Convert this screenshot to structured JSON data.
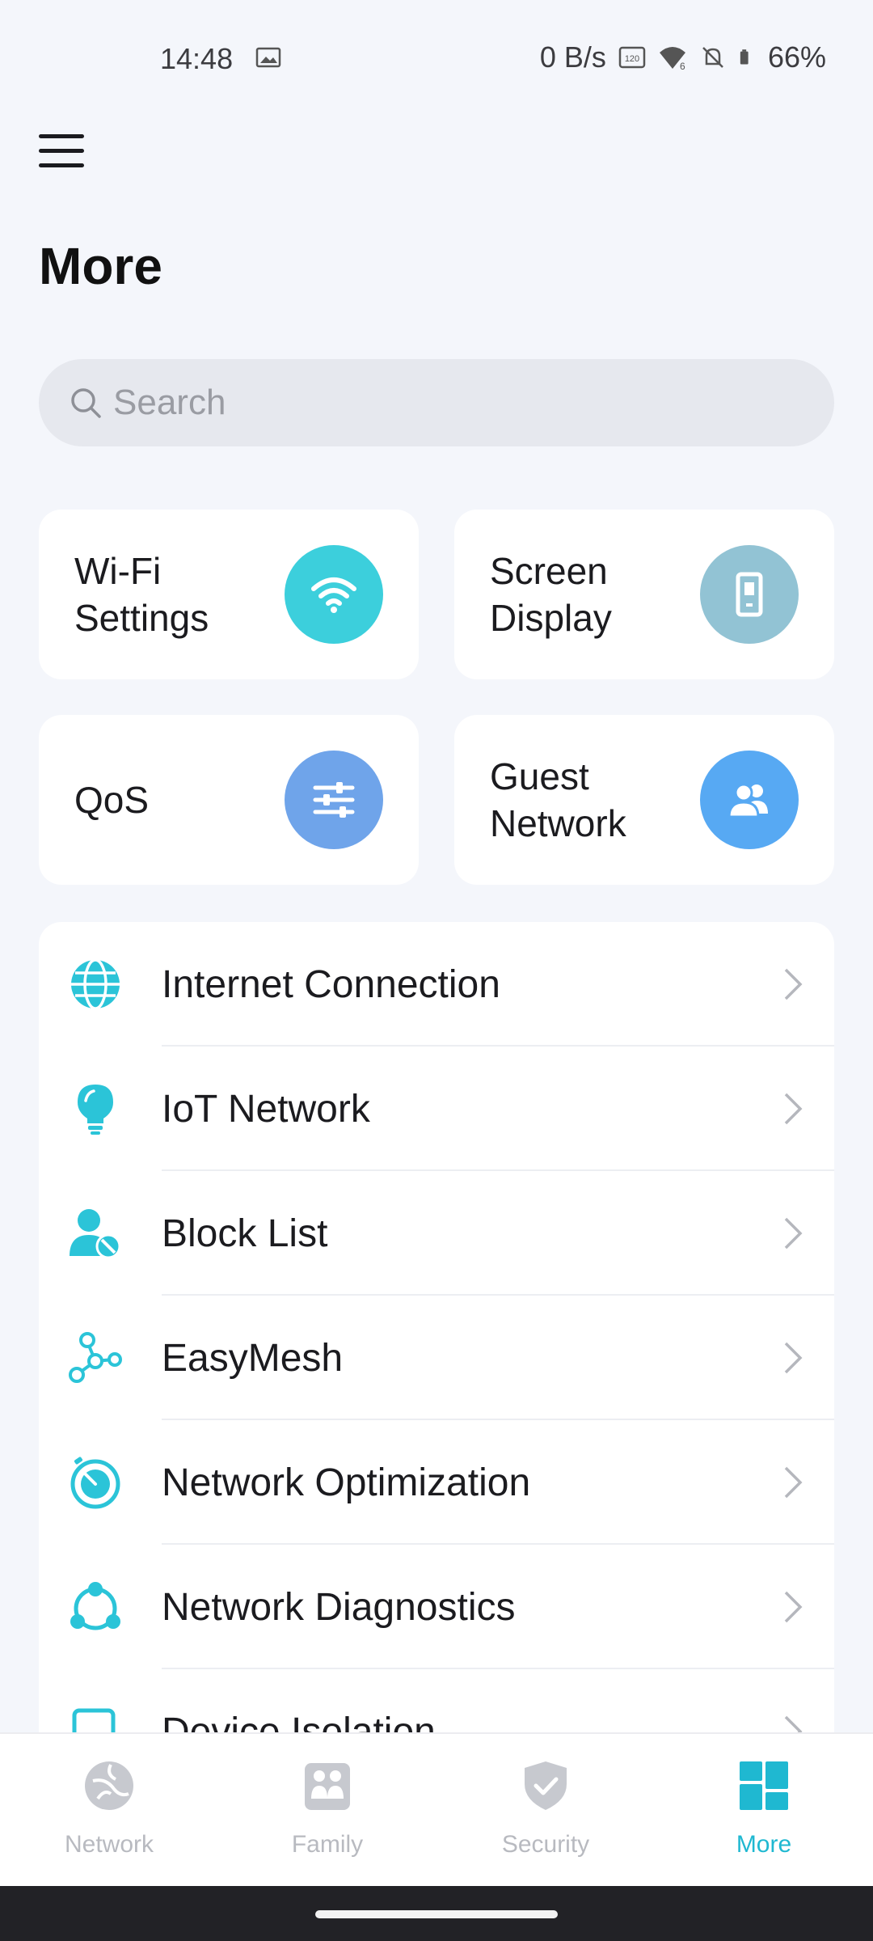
{
  "status_bar": {
    "time": "14:48",
    "net_speed": "0 B/s",
    "battery": "66%"
  },
  "header": {
    "title": "More"
  },
  "search": {
    "placeholder": "Search"
  },
  "tiles": [
    {
      "label": "Wi-Fi\nSettings",
      "icon": "wifi-icon",
      "color": "#3ccfdc"
    },
    {
      "label": "Screen\nDisplay",
      "icon": "screen-display-icon",
      "color": "#92c3d4"
    },
    {
      "label": "QoS",
      "icon": "sliders-icon",
      "color": "#6fa4ea"
    },
    {
      "label": "Guest\nNetwork",
      "icon": "guest-users-icon",
      "color": "#57a9f3"
    }
  ],
  "list": {
    "items": [
      {
        "label": "Internet Connection",
        "icon": "globe-icon"
      },
      {
        "label": "IoT Network",
        "icon": "lightbulb-icon"
      },
      {
        "label": "Block List",
        "icon": "user-block-icon"
      },
      {
        "label": "EasyMesh",
        "icon": "mesh-nodes-icon"
      },
      {
        "label": "Network Optimization",
        "icon": "stopwatch-icon"
      },
      {
        "label": "Network Diagnostics",
        "icon": "diagnostics-icon"
      },
      {
        "label": "Device Isolation",
        "icon": "device-isolation-icon"
      }
    ]
  },
  "bottom_nav": {
    "items": [
      {
        "label": "Network",
        "icon": "network-globe-icon",
        "active": false
      },
      {
        "label": "Family",
        "icon": "family-icon",
        "active": false
      },
      {
        "label": "Security",
        "icon": "shield-check-icon",
        "active": false
      },
      {
        "label": "More",
        "icon": "grid-icon",
        "active": true
      }
    ]
  },
  "colors": {
    "accent": "#1fb8d1",
    "background": "#f4f6fb",
    "inactive_nav": "#c4c6cc"
  }
}
